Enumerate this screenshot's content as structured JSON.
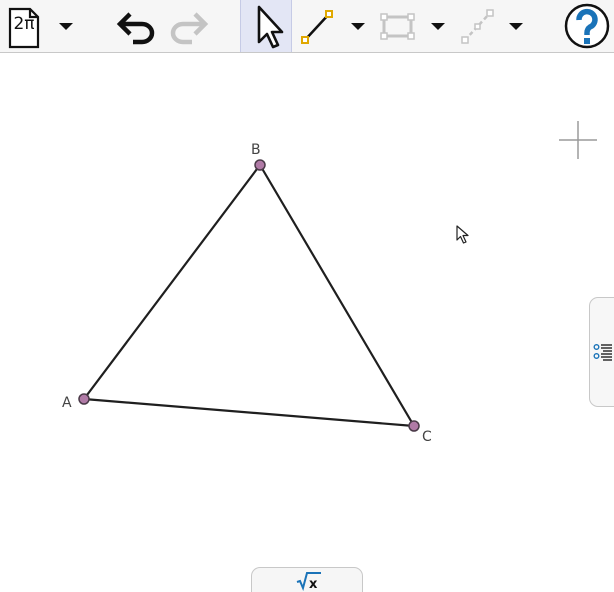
{
  "toolbar": {
    "file_button_label": "2π",
    "icons": [
      "file-icon",
      "dropdown-arrow-icon",
      "undo-icon",
      "redo-icon",
      "move-arrow-icon",
      "segment-icon",
      "rectangle-icon",
      "dashed-line-icon",
      "help-icon"
    ],
    "accent_color": "#e0a800",
    "active_tool_background": "#e3e6f5",
    "disabled_icon_color": "#c4c4c4",
    "help_color": "#1a73b8"
  },
  "canvas": {
    "zoom_control_icon": "plus-cross-icon",
    "point_color": "#b07aa6",
    "point_stroke": "#4a3a48",
    "segment_color": "#1f1f1f",
    "points": [
      {
        "name": "A"
      },
      {
        "name": "B"
      },
      {
        "name": "C"
      }
    ]
  },
  "side_panel_tab": {
    "icon": "list-properties-icon"
  },
  "algebra_tab": {
    "icon": "square-root-x-icon",
    "label": "√x"
  }
}
